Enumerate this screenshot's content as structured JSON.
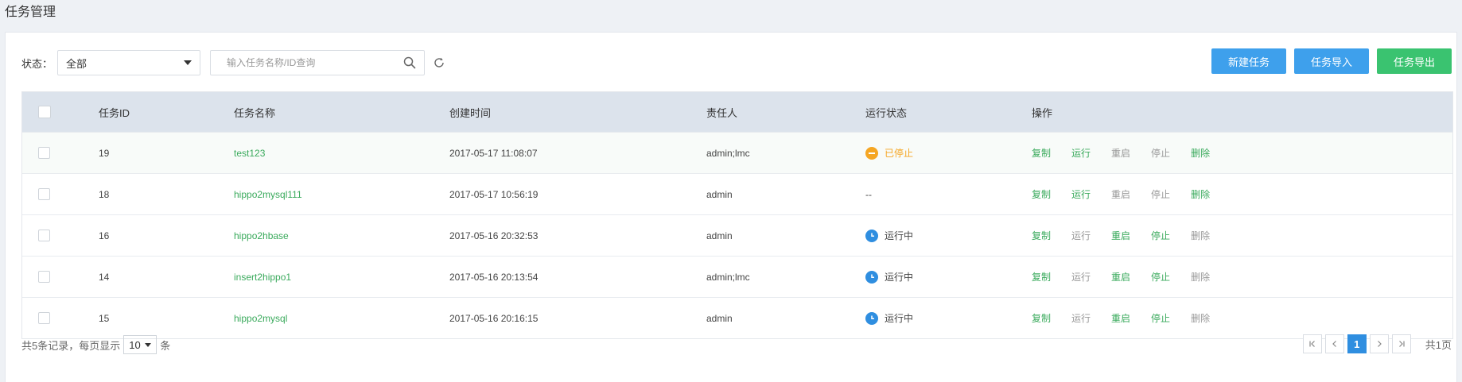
{
  "page": {
    "title": "任务管理"
  },
  "filter": {
    "status_label": "状态：",
    "status_value": "全部",
    "search_placeholder": "输入任务名称/ID查询"
  },
  "toolbar": {
    "new_label": "新建任务",
    "import_label": "任务导入",
    "export_label": "任务导出"
  },
  "table": {
    "headers": {
      "id": "任务ID",
      "name": "任务名称",
      "created": "创建时间",
      "owner": "责任人",
      "status": "运行状态",
      "ops": "操作"
    },
    "ops": {
      "copy": "复制",
      "run": "运行",
      "restart": "重启",
      "stop": "停止",
      "delete": "删除"
    },
    "rows": [
      {
        "id": "19",
        "name": "test123",
        "created": "2017-05-17 11:08:07",
        "owner": "admin;lmc",
        "status": "已停止"
      },
      {
        "id": "18",
        "name": "hippo2mysql111",
        "created": "2017-05-17 10:56:19",
        "owner": "admin",
        "status": "--"
      },
      {
        "id": "16",
        "name": "hippo2hbase",
        "created": "2017-05-16 20:32:53",
        "owner": "admin",
        "status": "运行中"
      },
      {
        "id": "14",
        "name": "insert2hippo1",
        "created": "2017-05-16 20:13:54",
        "owner": "admin;lmc",
        "status": "运行中"
      },
      {
        "id": "15",
        "name": "hippo2mysql",
        "created": "2017-05-16 20:16:15",
        "owner": "admin",
        "status": "运行中"
      }
    ]
  },
  "footer": {
    "total_text": "共5条记录，每页显示",
    "page_size": "10",
    "unit": "条",
    "current_page": "1",
    "page_total": "共1页"
  },
  "colors": {
    "primary": "#3ea0ec",
    "success": "#3ac370",
    "link": "#3aaa5c",
    "warning": "#f5a623",
    "running": "#2f8ee0"
  },
  "icons": [
    "search-icon",
    "refresh-icon",
    "caret-down-icon",
    "stopped-icon",
    "running-clock-icon",
    "first-page-icon",
    "prev-page-icon",
    "next-page-icon",
    "last-page-icon"
  ]
}
